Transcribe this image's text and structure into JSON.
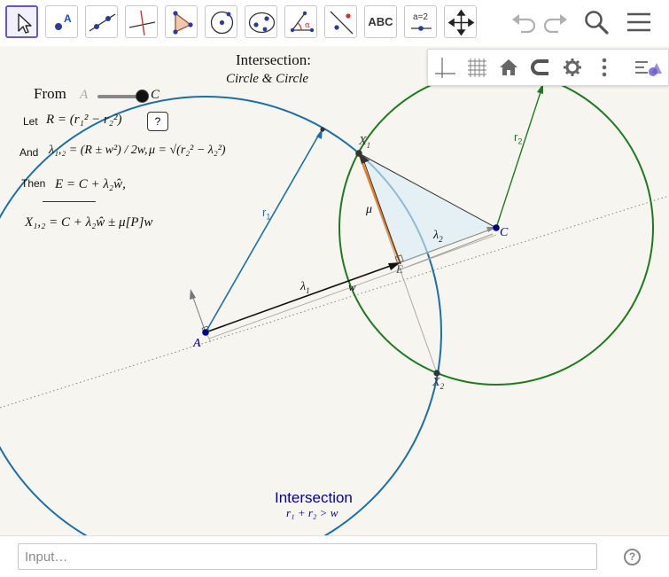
{
  "toolbar": {
    "tools": [
      {
        "name": "move-tool",
        "label": ""
      },
      {
        "name": "point-tool",
        "label": "A"
      },
      {
        "name": "line-tool",
        "label": ""
      },
      {
        "name": "perpendicular-line-tool",
        "label": ""
      },
      {
        "name": "polygon-tool",
        "label": ""
      },
      {
        "name": "circle-center-point-tool",
        "label": ""
      },
      {
        "name": "ellipse-tool",
        "label": ""
      },
      {
        "name": "angle-tool",
        "label": "α"
      },
      {
        "name": "reflect-tool",
        "label": ""
      },
      {
        "name": "text-tool",
        "label": "ABC"
      },
      {
        "name": "slider-tool",
        "label": "a=2"
      },
      {
        "name": "move-graphics-view-tool",
        "label": ""
      }
    ],
    "undo_icon": "undo-icon",
    "redo_icon": "redo-icon",
    "search_icon": "search-icon",
    "menu_icon": "menu-icon"
  },
  "stylebar": {
    "buttons": [
      "axes-icon",
      "grid-icon",
      "home-icon",
      "point-capturing-icon",
      "gear-icon",
      "more-vertical-icon",
      "style-bar-toggle-icon"
    ]
  },
  "canvas": {
    "title_line1": "Intersection:",
    "title_line2": "Circle & Circle",
    "from_label": "From",
    "slider_start": "A",
    "slider_end": "C",
    "let_label": "Let",
    "and_label": "And",
    "then_label": "Then",
    "help_button": "?",
    "formula_R": "R = (r₁² − r₂²)",
    "formula_lambda": "λ₁,₂ = (R ± w²) / 2w,",
    "formula_mu": "μ = √(r₂² − λ₂²)",
    "formula_E": "E = C + λ₂ŵ,",
    "formula_X": "X₁,₂ = C + λ₂ŵ ± μ[P]w",
    "bottom_title": "Intersection",
    "bottom_condition": "r₁ + r₂ > w",
    "labels": {
      "A": "A",
      "C": "C",
      "E": "E",
      "X1": "X",
      "X1_sub": "1",
      "X2": "X",
      "X2_sub": "2",
      "r1": "r",
      "r1_sub": "1",
      "r2": "r",
      "r2_sub": "2",
      "lambda1": "λ",
      "lambda1_sub": "1",
      "lambda2": "λ",
      "lambda2_sub": "2",
      "mu": "μ",
      "w": "w"
    },
    "colors": {
      "circle1": "#1b6fa8",
      "circle2": "#1e7a1e",
      "orange": "#f07b1a",
      "point": "#00008b",
      "bottom_title": "#0000a0"
    }
  },
  "input": {
    "placeholder": "Input…",
    "help_label": "?"
  }
}
